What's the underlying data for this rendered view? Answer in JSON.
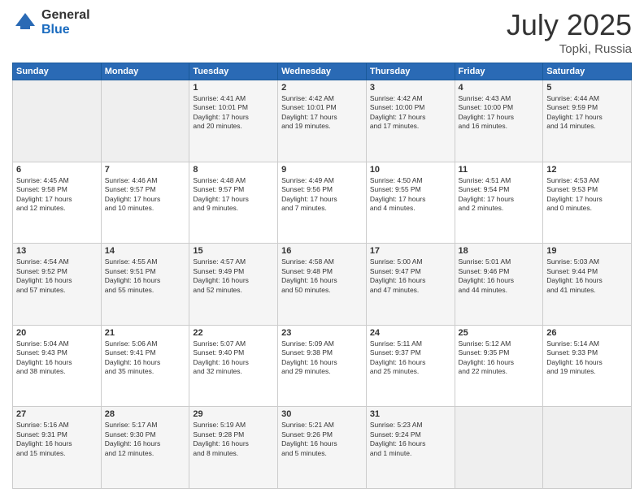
{
  "header": {
    "logo_general": "General",
    "logo_blue": "Blue",
    "title": "July 2025",
    "location": "Topki, Russia"
  },
  "weekdays": [
    "Sunday",
    "Monday",
    "Tuesday",
    "Wednesday",
    "Thursday",
    "Friday",
    "Saturday"
  ],
  "weeks": [
    [
      {
        "day": "",
        "info": ""
      },
      {
        "day": "",
        "info": ""
      },
      {
        "day": "1",
        "info": "Sunrise: 4:41 AM\nSunset: 10:01 PM\nDaylight: 17 hours\nand 20 minutes."
      },
      {
        "day": "2",
        "info": "Sunrise: 4:42 AM\nSunset: 10:01 PM\nDaylight: 17 hours\nand 19 minutes."
      },
      {
        "day": "3",
        "info": "Sunrise: 4:42 AM\nSunset: 10:00 PM\nDaylight: 17 hours\nand 17 minutes."
      },
      {
        "day": "4",
        "info": "Sunrise: 4:43 AM\nSunset: 10:00 PM\nDaylight: 17 hours\nand 16 minutes."
      },
      {
        "day": "5",
        "info": "Sunrise: 4:44 AM\nSunset: 9:59 PM\nDaylight: 17 hours\nand 14 minutes."
      }
    ],
    [
      {
        "day": "6",
        "info": "Sunrise: 4:45 AM\nSunset: 9:58 PM\nDaylight: 17 hours\nand 12 minutes."
      },
      {
        "day": "7",
        "info": "Sunrise: 4:46 AM\nSunset: 9:57 PM\nDaylight: 17 hours\nand 10 minutes."
      },
      {
        "day": "8",
        "info": "Sunrise: 4:48 AM\nSunset: 9:57 PM\nDaylight: 17 hours\nand 9 minutes."
      },
      {
        "day": "9",
        "info": "Sunrise: 4:49 AM\nSunset: 9:56 PM\nDaylight: 17 hours\nand 7 minutes."
      },
      {
        "day": "10",
        "info": "Sunrise: 4:50 AM\nSunset: 9:55 PM\nDaylight: 17 hours\nand 4 minutes."
      },
      {
        "day": "11",
        "info": "Sunrise: 4:51 AM\nSunset: 9:54 PM\nDaylight: 17 hours\nand 2 minutes."
      },
      {
        "day": "12",
        "info": "Sunrise: 4:53 AM\nSunset: 9:53 PM\nDaylight: 17 hours\nand 0 minutes."
      }
    ],
    [
      {
        "day": "13",
        "info": "Sunrise: 4:54 AM\nSunset: 9:52 PM\nDaylight: 16 hours\nand 57 minutes."
      },
      {
        "day": "14",
        "info": "Sunrise: 4:55 AM\nSunset: 9:51 PM\nDaylight: 16 hours\nand 55 minutes."
      },
      {
        "day": "15",
        "info": "Sunrise: 4:57 AM\nSunset: 9:49 PM\nDaylight: 16 hours\nand 52 minutes."
      },
      {
        "day": "16",
        "info": "Sunrise: 4:58 AM\nSunset: 9:48 PM\nDaylight: 16 hours\nand 50 minutes."
      },
      {
        "day": "17",
        "info": "Sunrise: 5:00 AM\nSunset: 9:47 PM\nDaylight: 16 hours\nand 47 minutes."
      },
      {
        "day": "18",
        "info": "Sunrise: 5:01 AM\nSunset: 9:46 PM\nDaylight: 16 hours\nand 44 minutes."
      },
      {
        "day": "19",
        "info": "Sunrise: 5:03 AM\nSunset: 9:44 PM\nDaylight: 16 hours\nand 41 minutes."
      }
    ],
    [
      {
        "day": "20",
        "info": "Sunrise: 5:04 AM\nSunset: 9:43 PM\nDaylight: 16 hours\nand 38 minutes."
      },
      {
        "day": "21",
        "info": "Sunrise: 5:06 AM\nSunset: 9:41 PM\nDaylight: 16 hours\nand 35 minutes."
      },
      {
        "day": "22",
        "info": "Sunrise: 5:07 AM\nSunset: 9:40 PM\nDaylight: 16 hours\nand 32 minutes."
      },
      {
        "day": "23",
        "info": "Sunrise: 5:09 AM\nSunset: 9:38 PM\nDaylight: 16 hours\nand 29 minutes."
      },
      {
        "day": "24",
        "info": "Sunrise: 5:11 AM\nSunset: 9:37 PM\nDaylight: 16 hours\nand 25 minutes."
      },
      {
        "day": "25",
        "info": "Sunrise: 5:12 AM\nSunset: 9:35 PM\nDaylight: 16 hours\nand 22 minutes."
      },
      {
        "day": "26",
        "info": "Sunrise: 5:14 AM\nSunset: 9:33 PM\nDaylight: 16 hours\nand 19 minutes."
      }
    ],
    [
      {
        "day": "27",
        "info": "Sunrise: 5:16 AM\nSunset: 9:31 PM\nDaylight: 16 hours\nand 15 minutes."
      },
      {
        "day": "28",
        "info": "Sunrise: 5:17 AM\nSunset: 9:30 PM\nDaylight: 16 hours\nand 12 minutes."
      },
      {
        "day": "29",
        "info": "Sunrise: 5:19 AM\nSunset: 9:28 PM\nDaylight: 16 hours\nand 8 minutes."
      },
      {
        "day": "30",
        "info": "Sunrise: 5:21 AM\nSunset: 9:26 PM\nDaylight: 16 hours\nand 5 minutes."
      },
      {
        "day": "31",
        "info": "Sunrise: 5:23 AM\nSunset: 9:24 PM\nDaylight: 16 hours\nand 1 minute."
      },
      {
        "day": "",
        "info": ""
      },
      {
        "day": "",
        "info": ""
      }
    ]
  ]
}
